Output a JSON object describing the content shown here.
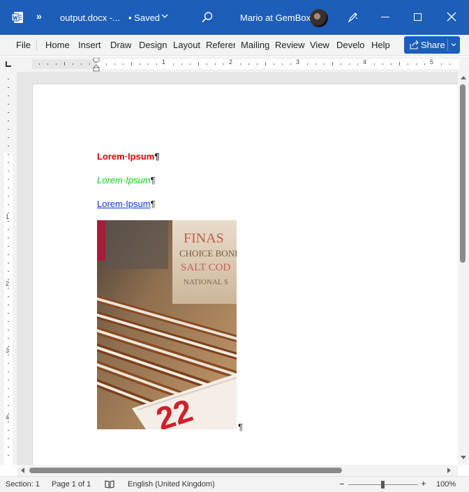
{
  "titlebar": {
    "app_icon": "word-icon",
    "more": "»",
    "filename": "output.docx  -...",
    "saved": "•  Saved",
    "user": "Mario at GemBox"
  },
  "ribbon": {
    "tabs": [
      "File",
      "Home",
      "Insert",
      "Draw",
      "Design",
      "Layout",
      "Referen",
      "Mailing",
      "Review",
      "View",
      "Develo",
      "Help"
    ],
    "share_label": "Share"
  },
  "ruler": {
    "numbers": [
      "1",
      "2",
      "3",
      "4",
      "5"
    ]
  },
  "vruler": {
    "numbers": [
      "1",
      "2",
      "3",
      "4"
    ]
  },
  "document": {
    "paragraphs": [
      {
        "text": "Lorem·Ipsum",
        "style": "bold red",
        "color": "#e00000"
      },
      {
        "text": "Lorem·Ipsum",
        "style": "italic green",
        "color": "#10d210"
      },
      {
        "text": "Lorem·Ipsum",
        "style": "hyperlink",
        "color": "#0b32d9"
      }
    ],
    "pilcrow": "¶",
    "image": "photo of wooden folding rulers in front of a vintage Choice Boneless Salt Cod box and a numbered red label"
  },
  "status": {
    "section": "Section: 1",
    "page": "Page 1 of 1",
    "language": "English (United Kingdom)",
    "zoom": "100%",
    "zoom_level": 1.0
  },
  "colors": {
    "titlebar": "#1c5eb9",
    "ribbon": "#f3f3f3",
    "red_text": "#e00000",
    "green_text": "#10d210",
    "link_text": "#0b32d9"
  }
}
